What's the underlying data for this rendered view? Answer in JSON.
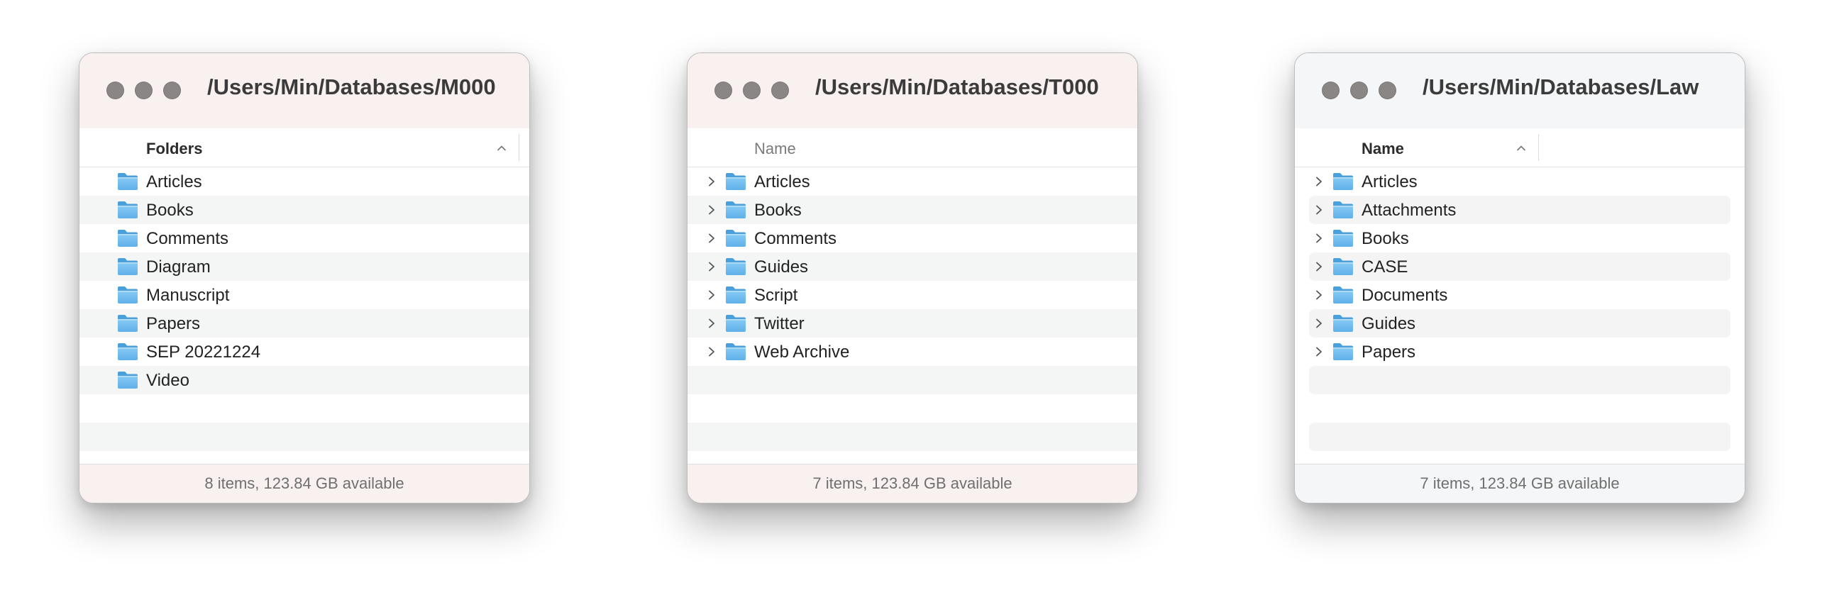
{
  "windows": [
    {
      "title": "/Users/Min/Databases/M000",
      "column_header": "Folders",
      "items": [
        {
          "label": "Articles"
        },
        {
          "label": "Books"
        },
        {
          "label": "Comments"
        },
        {
          "label": "Diagram"
        },
        {
          "label": "Manuscript"
        },
        {
          "label": "Papers"
        },
        {
          "label": "SEP 20221224"
        },
        {
          "label": "Video"
        }
      ],
      "status": "8 items, 123.84 GB available"
    },
    {
      "title": "/Users/Min/Databases/T000",
      "column_header": "Name",
      "items": [
        {
          "label": "Articles"
        },
        {
          "label": "Books"
        },
        {
          "label": "Comments"
        },
        {
          "label": "Guides"
        },
        {
          "label": "Script"
        },
        {
          "label": "Twitter"
        },
        {
          "label": "Web Archive"
        }
      ],
      "status": "7 items, 123.84 GB available"
    },
    {
      "title": "/Users/Min/Databases/Law",
      "column_header": "Name",
      "items": [
        {
          "label": "Articles"
        },
        {
          "label": "Attachments"
        },
        {
          "label": "Books"
        },
        {
          "label": "CASE"
        },
        {
          "label": "Documents"
        },
        {
          "label": "Guides"
        },
        {
          "label": "Papers"
        }
      ],
      "status": "7 items, 123.84 GB available"
    }
  ],
  "icons": {
    "folder": "folder-icon",
    "disclosure": "chevron-right-icon",
    "sort": "chevron-up-icon",
    "window_controls": [
      "close-button",
      "minimize-button",
      "zoom-button"
    ]
  },
  "colors": {
    "folder_blue": "#6fb9ee",
    "traffic_light_inactive": "#8b8686",
    "row_stripe": "#f4f5f5",
    "titlebar_pink": "#f8f1f0",
    "titlebar_gray": "#f5f6f7"
  }
}
